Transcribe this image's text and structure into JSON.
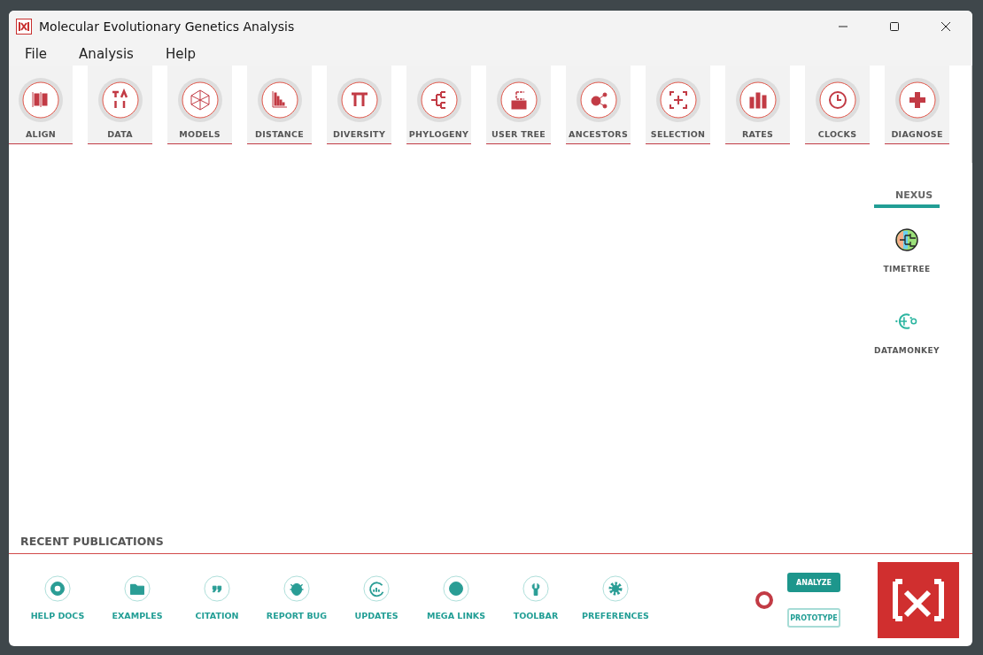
{
  "window": {
    "title": "Molecular Evolutionary Genetics Analysis"
  },
  "menu": [
    "File",
    "Analysis",
    "Help"
  ],
  "toolbar": [
    {
      "label": "ALIGN"
    },
    {
      "label": "DATA"
    },
    {
      "label": "MODELS"
    },
    {
      "label": "DISTANCE"
    },
    {
      "label": "DIVERSITY"
    },
    {
      "label": "PHYLOGENY"
    },
    {
      "label": "USER TREE"
    },
    {
      "label": "ANCESTORS"
    },
    {
      "label": "SELECTION"
    },
    {
      "label": "RATES"
    },
    {
      "label": "CLOCKS"
    },
    {
      "label": "DIAGNOSE"
    }
  ],
  "nexus": {
    "title": "NEXUS",
    "links": [
      {
        "label": "TIMETREE"
      },
      {
        "label": "DATAMONKEY"
      }
    ]
  },
  "recent_publications": {
    "title": "RECENT PUBLICATIONS"
  },
  "footer": {
    "links": [
      {
        "label": "HELP DOCS"
      },
      {
        "label": "EXAMPLES"
      },
      {
        "label": "CITATION"
      },
      {
        "label": "REPORT BUG"
      },
      {
        "label": "UPDATES"
      },
      {
        "label": "MEGA LINKS"
      },
      {
        "label": "TOOLBAR"
      },
      {
        "label": "PREFERENCES"
      }
    ],
    "modes": [
      {
        "label": "ANALYZE",
        "selected": true
      },
      {
        "label": "PROTOTYPE",
        "selected": false
      }
    ]
  }
}
